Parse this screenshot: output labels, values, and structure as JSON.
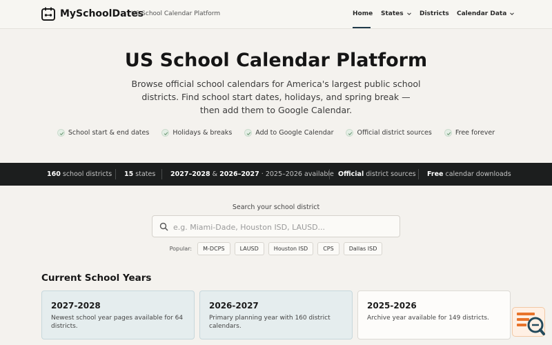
{
  "header": {
    "brand": "MySchoolDates",
    "tagline": "US School Calendar Platform",
    "nav": {
      "home": "Home",
      "states": "States",
      "districts": "Districts",
      "calendar_data": "Calendar Data"
    }
  },
  "hero": {
    "title": "US School Calendar Platform",
    "description": "Browse official school calendars for America's largest public school districts. Find school start dates, holidays, and spring break — then add them to Google Calendar.",
    "features": [
      "School start & end dates",
      "Holidays & breaks",
      "Add to Google Calendar",
      "Official district sources",
      "Free forever"
    ]
  },
  "stats": {
    "districts_count": "160",
    "districts_label": "school districts",
    "states_count": "15",
    "states_label": "states",
    "year_a": "2027–2028",
    "amp": "&",
    "year_b": "2026–2027",
    "year_available": "· 2025–2026 available",
    "official": "Official",
    "official_label": "district sources",
    "free": "Free",
    "free_label": "calendar downloads"
  },
  "search": {
    "label": "Search your school district",
    "placeholder": "e.g. Miami-Dade, Houston ISD, LAUSD...",
    "popular_label": "Popular:",
    "popular": [
      "M-DCPS",
      "LAUSD",
      "Houston ISD",
      "CPS",
      "Dallas ISD"
    ]
  },
  "years": {
    "title": "Current School Years",
    "cards": [
      {
        "title": "2027-2028",
        "desc": "Newest school year pages available for 64 districts."
      },
      {
        "title": "2026-2027",
        "desc": "Primary planning year with 160 district calendars."
      },
      {
        "title": "2025-2026",
        "desc": "Archive year available for 149 districts."
      }
    ]
  },
  "colors": {
    "stats_bg": "#1c1e1e",
    "accent": "#1f3a4a",
    "card_highlight": "#e5edee",
    "widget": "#e8732a"
  },
  "icons": {
    "logo": "calendar-logo-icon",
    "search": "search-icon",
    "check": "check-icon",
    "chevron": "chevron-down-icon",
    "widget": "search-document-icon"
  }
}
